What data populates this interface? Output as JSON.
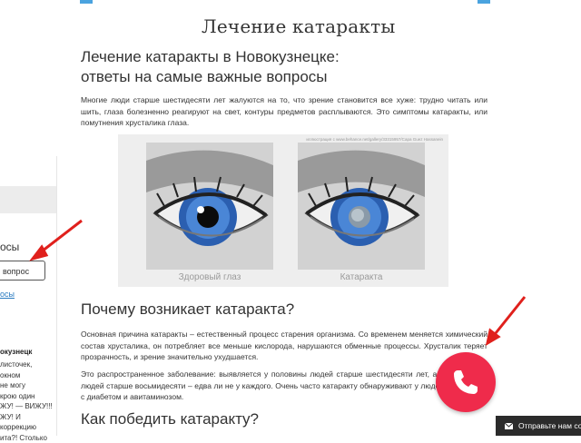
{
  "page_title": "Лечение катаракты",
  "article": {
    "heading_line1": "Лечение катаракты в Новокузнецке:",
    "heading_line2": "ответы на самые важные вопросы",
    "intro": "Многие люди старше шестидесяти лет жалуются на то, что зрение становится все хуже: трудно читать или шить, глаза болезненно реагируют на свет, контуры предметов расплываются. Это симптомы катаракты, или помутнения хрусталика глаза.",
    "figure": {
      "credit": "иллюстрация с www.behance.net/gallery/33315957/Сара Guez Hassanein",
      "caption_healthy": "Здоровый глаз",
      "caption_cataract": "Катаракта"
    },
    "why_heading": "Почему возникает катаракта?",
    "why_text": "Основная причина катаракты – естественный процесс старения организма. Со временем меняется химический состав хрусталика, он потребляет все меньше кислорода, нарушаются обменные процессы. Хрусталик теряет прозрачность, и зрение значительно ухудшается.",
    "common_text": "Это распространенное заболевание: выявляется у половины людей старше шестидесяти лет, а у людей старше восьмидесяти – едва ли не у каждого. Очень часто катаракту обнаруживают у людей с диабетом и авитаминозом.",
    "how_heading": "Как победить катаракту?"
  },
  "sidebar": {
    "heading_fragment": "осы",
    "question_box": "вопрос",
    "link_fragment": "осы",
    "city_fragment": "окузнецк",
    "text_lines": [
      "листочек,",
      "окном",
      "не могу",
      "крою один",
      "ЖУ! — ВИЖУ!!!",
      "ЖУ! И",
      "коррекцию",
      "ита?! Столько"
    ]
  },
  "chat_bar": {
    "label": "Отправьте нам соо"
  },
  "colors": {
    "accent": "#4aa3df",
    "call_button": "#ef2b4b",
    "arrow": "#e0201c",
    "link": "#2a7bc0",
    "chat_bar": "#2b2b2b"
  },
  "icons": {
    "call": "phone-icon",
    "chat": "mail-icon"
  }
}
